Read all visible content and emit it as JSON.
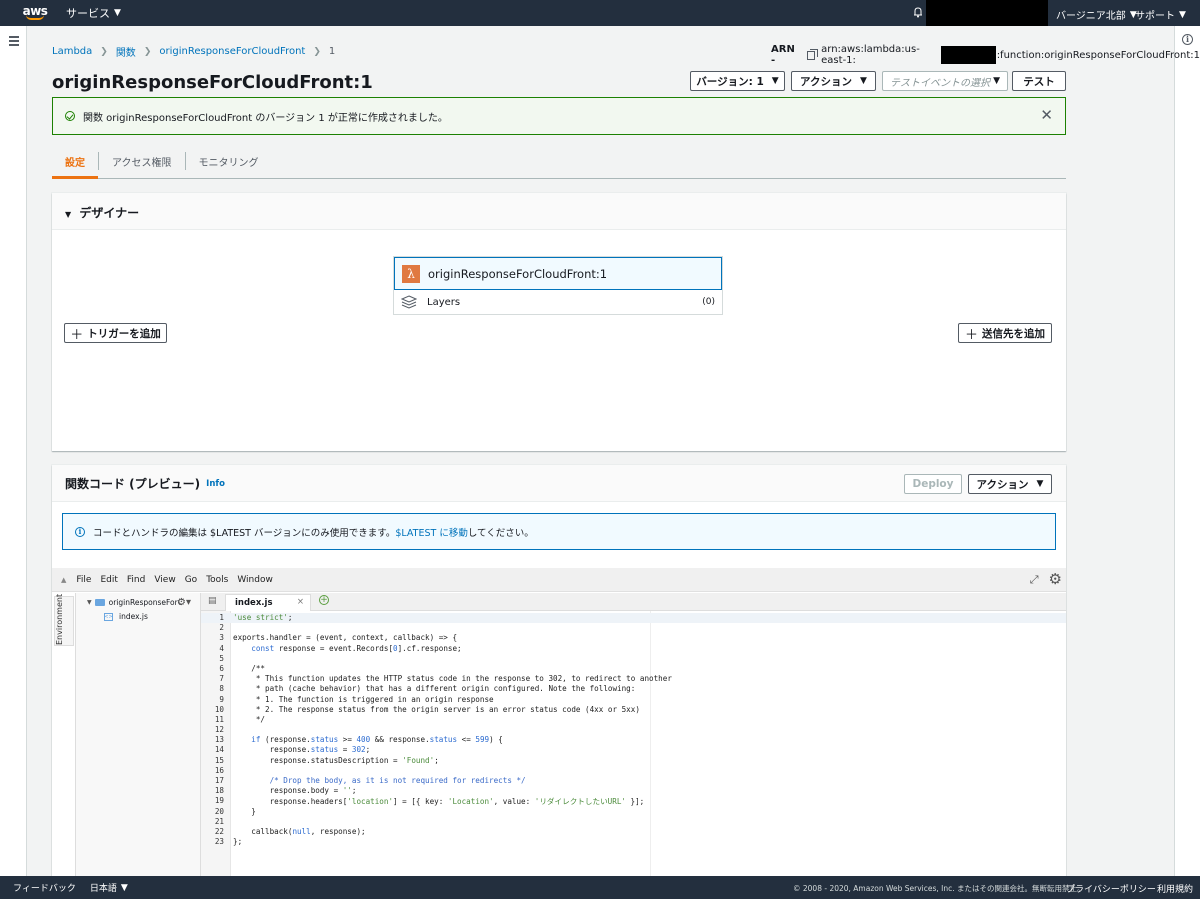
{
  "topnav": {
    "logo": "aws",
    "services": "サービス",
    "region": "バージニア北部",
    "support": "サポート"
  },
  "breadcrumb": {
    "items": [
      "Lambda",
      "関数",
      "originResponseForCloudFront",
      "1"
    ]
  },
  "arn": {
    "label": "ARN -",
    "prefix": "arn:aws:lambda:us-east-1:",
    "suffix": ":function:originResponseForCloudFront:1"
  },
  "page": {
    "title": "originResponseForCloudFront:1"
  },
  "toolbar": {
    "version": "バージョン: 1",
    "actions": "アクション",
    "test_event_placeholder": "テストイベントの選択",
    "test": "テスト"
  },
  "flash": {
    "message": "関数 originResponseForCloudFront のバージョン 1 が正常に作成されました。"
  },
  "tabs": [
    {
      "label": "設定"
    },
    {
      "label": "アクセス権限"
    },
    {
      "label": "モニタリング"
    }
  ],
  "designer": {
    "title": "デザイナー",
    "function_name": "originResponseForCloudFront:1",
    "layers_label": "Layers",
    "layers_count": "(0)",
    "add_trigger": "トリガーを追加",
    "add_destination": "送信先を追加"
  },
  "code_panel": {
    "title": "関数コード (プレビュー)",
    "info": "Info",
    "deploy": "Deploy",
    "actions": "アクション",
    "notice_pre": "コードとハンドラの編集は $LATEST バージョンにのみ使用できます。",
    "notice_link": "$LATEST に移動",
    "notice_post": "してください。"
  },
  "ide": {
    "menu": [
      "File",
      "Edit",
      "Find",
      "View",
      "Go",
      "Tools",
      "Window"
    ],
    "environment": "Environment",
    "folder": "originResponseForC",
    "file": "index.js",
    "tab": "index.js"
  },
  "footer": {
    "feedback": "フィードバック",
    "language": "日本語",
    "copyright": "© 2008 - 2020, Amazon Web Services, Inc. またはその関連会社。無断転用禁止。",
    "privacy": "プライバシーポリシー",
    "terms": "利用規約"
  }
}
